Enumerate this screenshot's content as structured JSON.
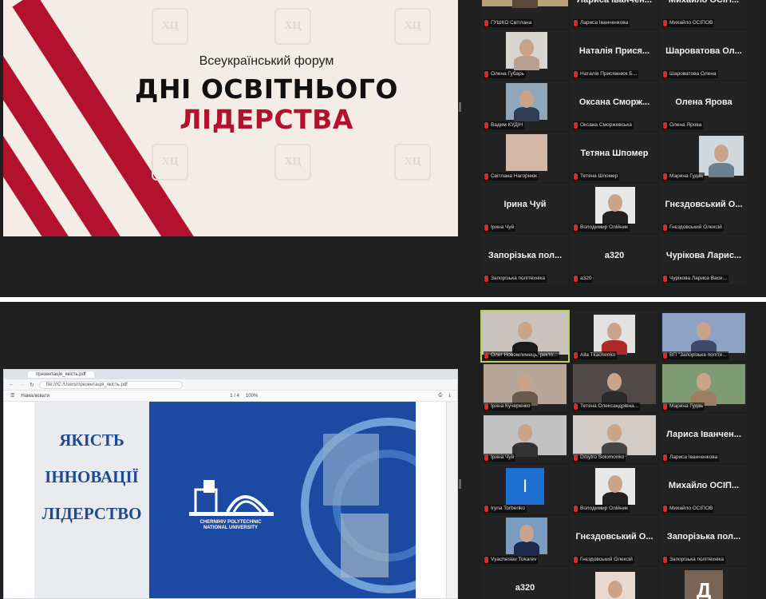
{
  "top": {
    "slide": {
      "subtitle": "Всеукраїнський форум",
      "title_line1": "ДНІ ОСВІТНЬОГО",
      "title_line2": "ЛІДЕРСТВА",
      "emblem_glyph": "ХЦ"
    },
    "participants": [
      {
        "tile_name": "",
        "label": "ГУШКО Світлана"
      },
      {
        "tile_name": "Лариса Іванчен...",
        "label": "Лариса Іванченкова"
      },
      {
        "tile_name": "Михайло ОСІП...",
        "label": "Михайло ОСІПОВ"
      },
      {
        "tile_name": "",
        "label": "Олена Губарь"
      },
      {
        "tile_name": "Наталія Прися...",
        "label": "Наталія Присяжнюк Б..."
      },
      {
        "tile_name": "Шароватова Ол...",
        "label": "Шароватова Олена"
      },
      {
        "tile_name": "",
        "label": "Вадим КУДІН"
      },
      {
        "tile_name": "Оксана Сморж...",
        "label": "Оксана Сморжевська"
      },
      {
        "tile_name": "Олена Ярова",
        "label": "Олена Ярова"
      },
      {
        "tile_name": "",
        "label": "Світлана Нагорнюк"
      },
      {
        "tile_name": "Тетяна Шпомер",
        "label": "Тетяна Шпомер"
      },
      {
        "tile_name": "",
        "label": "Марина Гудаь"
      },
      {
        "tile_name": "Ірина Чуй",
        "label": "Ірина Чуй"
      },
      {
        "tile_name": "",
        "label": "Володимир Олійник"
      },
      {
        "tile_name": "Гнєздовський О...",
        "label": "Гнєздовський Олексій"
      },
      {
        "tile_name": "Запорізька пол...",
        "label": "Запорізька політехніка"
      },
      {
        "tile_name": "а320",
        "label": "а320"
      },
      {
        "tile_name": "Чурікова Ларис...",
        "label": "Чурікова Лариса Васи..."
      }
    ]
  },
  "bottom": {
    "browser": {
      "tab_label": "презентація_якість.pdf",
      "address": "file:///C:/Users/презентація_якість.pdf",
      "toolbar_left": "Намалювати",
      "page_counter": "1 / 4",
      "zoom": "100%"
    },
    "slide": {
      "words": [
        "ЯКІСТЬ",
        "ІННОВАЦІЇ",
        "ЛІДЕРСТВО"
      ],
      "university_line1": "CHERNIHIV POLYTECHNIC",
      "university_line2": "NATIONAL UNIVERSITY"
    },
    "participants": [
      {
        "tile_name": "",
        "label": "Олег Новомлинець, ректо..."
      },
      {
        "tile_name": "",
        "label": "Alla Tkachenko"
      },
      {
        "tile_name": "",
        "label": "ВП \"Запорізька політе..."
      },
      {
        "tile_name": "",
        "label": "Ірина Кучеренко"
      },
      {
        "tile_name": "",
        "label": "Тетяна Олександрівна..."
      },
      {
        "tile_name": "",
        "label": "Марина Гудаь"
      },
      {
        "tile_name": "",
        "label": "Ірина Чуй"
      },
      {
        "tile_name": "",
        "label": "Dmytro Solomonko"
      },
      {
        "tile_name": "Лариса Іванчен...",
        "label": "Лариса Іванченкова"
      },
      {
        "tile_name": "",
        "label": "Iryna Torbenko"
      },
      {
        "tile_name": "",
        "label": "Володимир Олійник"
      },
      {
        "tile_name": "Михайло ОСІП...",
        "label": "Михайло ОСІПОВ"
      },
      {
        "tile_name": "",
        "label": "Vyacheslav Tokarev"
      },
      {
        "tile_name": "Гнєздовський О...",
        "label": "Гнєздовський Олексій"
      },
      {
        "tile_name": "Запорізька пол...",
        "label": "Запорізька політехніка"
      },
      {
        "tile_name": "а320",
        "label": ""
      },
      {
        "tile_name": "",
        "label": ""
      },
      {
        "tile_name": "",
        "label": ""
      }
    ],
    "avatar_letter_i": "I",
    "avatar_letter_d": "Д"
  }
}
